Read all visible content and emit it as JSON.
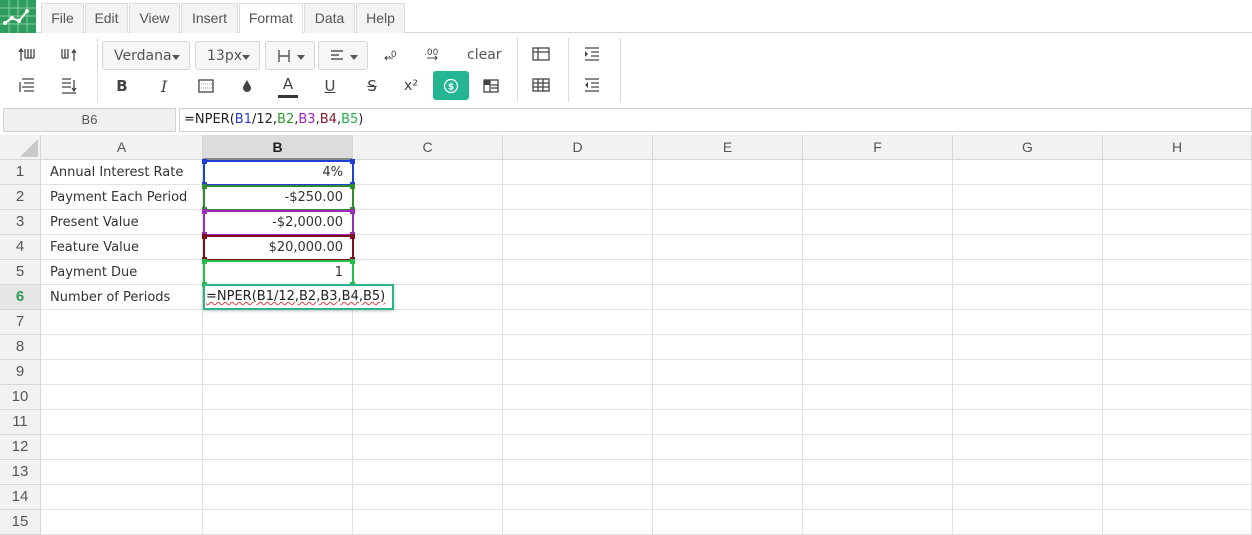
{
  "menu": {
    "items": [
      {
        "label": "File"
      },
      {
        "label": "Edit"
      },
      {
        "label": "View"
      },
      {
        "label": "Insert"
      },
      {
        "label": "Format",
        "active": true
      },
      {
        "label": "Data"
      },
      {
        "label": "Help"
      }
    ]
  },
  "toolbar": {
    "font_family": "Verdana",
    "font_size": "13px",
    "clear_label": "clear",
    "accent_color": "#24b592"
  },
  "formula_bar": {
    "name_box": "B6",
    "formula_parts": [
      {
        "text": "=NPER(",
        "color": "#222222"
      },
      {
        "text": "B1",
        "color": "#2b3ccf"
      },
      {
        "text": "/12,",
        "color": "#222222"
      },
      {
        "text": "B2",
        "color": "#2e9c2e"
      },
      {
        "text": ",",
        "color": "#222222"
      },
      {
        "text": "B3",
        "color": "#a020c0"
      },
      {
        "text": ",",
        "color": "#222222"
      },
      {
        "text": "B4",
        "color": "#8a1a2a"
      },
      {
        "text": ",",
        "color": "#222222"
      },
      {
        "text": "B5",
        "color": "#22b04a"
      },
      {
        "text": ")",
        "color": "#222222"
      }
    ]
  },
  "sheet": {
    "columns": [
      "A",
      "B",
      "C",
      "D",
      "E",
      "F",
      "G",
      "H"
    ],
    "selected_column": "B",
    "rows": [
      "1",
      "2",
      "3",
      "4",
      "5",
      "6",
      "7",
      "8",
      "9",
      "10",
      "11",
      "12",
      "13",
      "14",
      "15"
    ],
    "selected_row": "6",
    "cells": {
      "A1": "Annual Interest Rate",
      "A2": "Payment Each Period",
      "A3": "Present Value",
      "A4": "Feature Value",
      "A5": "Payment Due",
      "A6": "Number of Periods",
      "B1": "4%",
      "B2": "-$250.00",
      "B3": "-$2,000.00",
      "B4": "$20,000.00",
      "B5": "1"
    },
    "editor_text": "=NPER(B1/12,B2,B3,B4,B5)",
    "ref_colors": {
      "B1": "#1f3fd6",
      "B2": "#2e8b2e",
      "B3": "#9c2bb8",
      "B4": "#7a1020",
      "B5": "#25c04a"
    }
  }
}
